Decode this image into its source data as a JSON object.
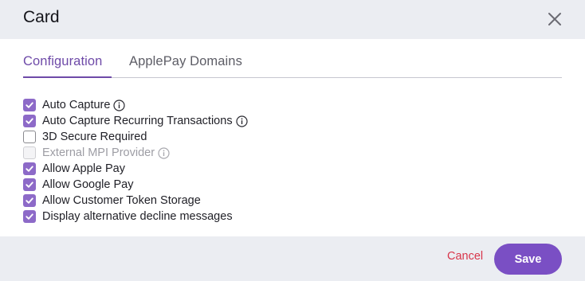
{
  "modal": {
    "title": "Card",
    "close_icon": "close-icon"
  },
  "tabs": [
    {
      "label": "Configuration",
      "active": true
    },
    {
      "label": "ApplePay Domains",
      "active": false
    }
  ],
  "options": [
    {
      "label": "Auto Capture",
      "checked": true,
      "disabled": false,
      "info": true
    },
    {
      "label": "Auto Capture Recurring Transactions",
      "checked": true,
      "disabled": false,
      "info": true
    },
    {
      "label": "3D Secure Required",
      "checked": false,
      "disabled": false,
      "info": false
    },
    {
      "label": "External MPI Provider",
      "checked": false,
      "disabled": true,
      "info": true
    },
    {
      "label": "Allow Apple Pay",
      "checked": true,
      "disabled": false,
      "info": false
    },
    {
      "label": "Allow Google Pay",
      "checked": true,
      "disabled": false,
      "info": false
    },
    {
      "label": "Allow Customer Token Storage",
      "checked": true,
      "disabled": false,
      "info": false
    },
    {
      "label": "Display alternative decline messages",
      "checked": true,
      "disabled": false,
      "info": false
    }
  ],
  "footer": {
    "cancel_label": "Cancel",
    "save_label": "Save"
  },
  "colors": {
    "accent": "#7a4fc4",
    "checkbox_checked": "#8d6ac8",
    "cancel": "#d8354a",
    "header_bg": "#ebedf2"
  }
}
